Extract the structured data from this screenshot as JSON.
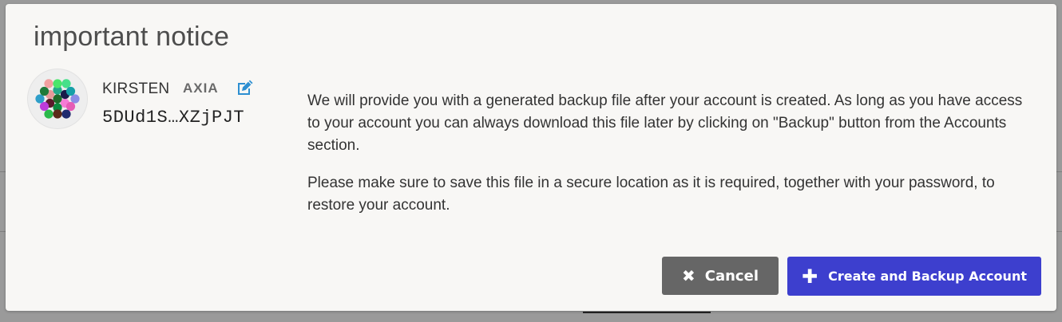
{
  "modal": {
    "title": "important notice"
  },
  "account": {
    "name": "KIRSTEN",
    "tag": "AXIA",
    "address": "5DUd1S…XZjPJT",
    "identicon_colors": [
      "#1e6b2a",
      "#f57bd5",
      "#0b8a3e",
      "#5b1a2a",
      "#e69a9a",
      "#23a98a",
      "#1a1a4a",
      "#8c8ce6",
      "#e65cb6",
      "#1f2a6e",
      "#5c2a1a",
      "#2ab84a",
      "#bd3cd9",
      "#2e9ec9",
      "#1e7a3a",
      "#f0a0a0",
      "#4ae66b",
      "#46e08a",
      "#16a0a8",
      "#2a4a8c"
    ]
  },
  "notice": {
    "paragraph1": "We will provide you with a generated backup file after your account is created. As long as you have access to your account you can always download this file later by clicking on \"Backup\" button from the Accounts section.",
    "paragraph2": "Please make sure to save this file in a secure location as it is required, together with your password, to restore your account."
  },
  "buttons": {
    "cancel_label": "Cancel",
    "cancel_icon": "close-icon",
    "create_label": "Create and Backup Account",
    "create_icon": "plus-icon"
  },
  "colors": {
    "primary": "#3d3fce",
    "secondary": "#666666",
    "edit_icon": "#2d8fd1"
  }
}
